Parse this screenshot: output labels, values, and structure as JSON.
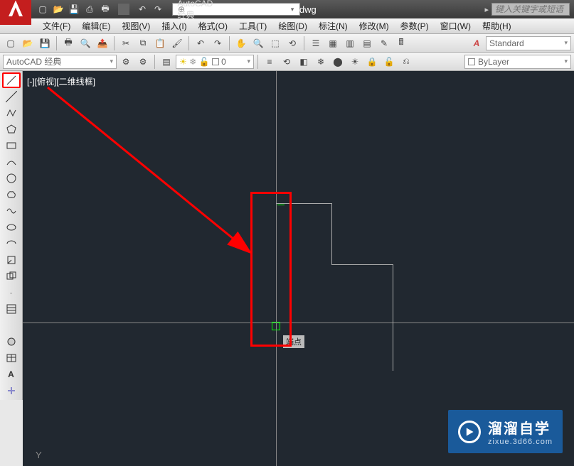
{
  "title": {
    "document": "Drawing1.dwg",
    "workspace": "AutoCAD 经典",
    "search_placeholder": "键入关键字或短语"
  },
  "menus": [
    "文件(F)",
    "编辑(E)",
    "视图(V)",
    "插入(I)",
    "格式(O)",
    "工具(T)",
    "绘图(D)",
    "标注(N)",
    "修改(M)",
    "参数(P)",
    "窗口(W)",
    "帮助(H)"
  ],
  "row2": {
    "workspace": "AutoCAD 经典",
    "layer_state": "0",
    "text_style": "Standard"
  },
  "row3": {
    "bylayer": "ByLayer"
  },
  "canvas": {
    "view_label": "[-][俯视][二维线框]",
    "snap_tip": "端点",
    "ucs_y": "Y"
  },
  "watermark": {
    "main": "溜溜自学",
    "sub": "zixue.3d66.com"
  }
}
